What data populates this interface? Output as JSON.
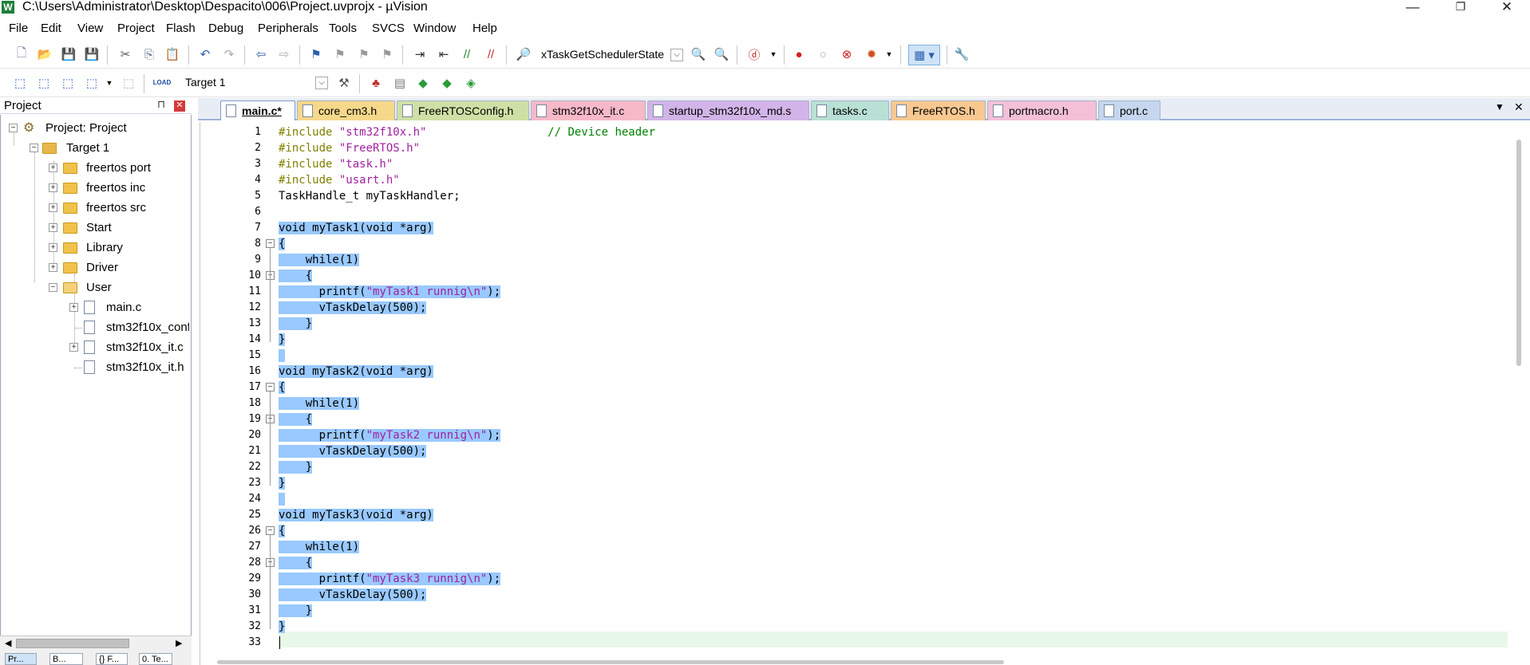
{
  "window": {
    "title": "C:\\Users\\Administrator\\Desktop\\Despacito\\006\\Project.uvprojx - µVision",
    "app_icon": "W"
  },
  "menu": [
    "File",
    "Edit",
    "View",
    "Project",
    "Flash",
    "Debug",
    "Peripherals",
    "Tools",
    "SVCS",
    "Window",
    "Help"
  ],
  "toolbar1": {
    "function_combo": "xTaskGetSchedulerState"
  },
  "toolbar2": {
    "target_combo": "Target 1",
    "load_label": "LOAD"
  },
  "project_panel": {
    "title": "Project",
    "root": "Project: Project",
    "target": "Target 1",
    "groups": [
      "freertos port",
      "freertos inc",
      "freertos src",
      "Start",
      "Library",
      "Driver",
      "User"
    ],
    "files": [
      "main.c",
      "stm32f10x_conf",
      "stm32f10x_it.c",
      "stm32f10x_it.h"
    ],
    "bottom_tabs": [
      "Pr...",
      "B...",
      "{} F...",
      "0. Te..."
    ]
  },
  "tabs": [
    {
      "label": "main.c*",
      "color": "#9db3d8",
      "active": true
    },
    {
      "label": "core_cm3.h",
      "color": "#f5d88a"
    },
    {
      "label": "FreeRTOSConfig.h",
      "color": "#cfe0a6"
    },
    {
      "label": "stm32f10x_it.c",
      "color": "#f7b8c8"
    },
    {
      "label": "startup_stm32f10x_md.s",
      "color": "#d2b4e8"
    },
    {
      "label": "tasks.c",
      "color": "#b9e0d4"
    },
    {
      "label": "FreeRTOS.h",
      "color": "#f9c891"
    },
    {
      "label": "portmacro.h",
      "color": "#f3c0d8"
    },
    {
      "label": "port.c",
      "color": "#c5d6ee"
    }
  ],
  "code": [
    {
      "n": "1",
      "text": "#include \"stm32f10x.h\"                  // Device header"
    },
    {
      "n": "2",
      "text": "#include \"FreeRTOS.h\""
    },
    {
      "n": "3",
      "text": "#include \"task.h\""
    },
    {
      "n": "4",
      "text": "#include \"usart.h\""
    },
    {
      "n": "5",
      "text": "TaskHandle_t myTaskHandler;"
    },
    {
      "n": "6",
      "text": ""
    },
    {
      "n": "7",
      "text": "void myTask1(void *arg)"
    },
    {
      "n": "8",
      "text": "{"
    },
    {
      "n": "9",
      "text": "    while(1)"
    },
    {
      "n": "10",
      "text": "    {"
    },
    {
      "n": "11",
      "text": "      printf(\"myTask1 runnig\\n\");"
    },
    {
      "n": "12",
      "text": "      vTaskDelay(500);"
    },
    {
      "n": "13",
      "text": "    }"
    },
    {
      "n": "14",
      "text": "}"
    },
    {
      "n": "15",
      "text": ""
    },
    {
      "n": "16",
      "text": "void myTask2(void *arg)"
    },
    {
      "n": "17",
      "text": "{"
    },
    {
      "n": "18",
      "text": "    while(1)"
    },
    {
      "n": "19",
      "text": "    {"
    },
    {
      "n": "20",
      "text": "      printf(\"myTask2 runnig\\n\");"
    },
    {
      "n": "21",
      "text": "      vTaskDelay(500);"
    },
    {
      "n": "22",
      "text": "    }"
    },
    {
      "n": "23",
      "text": "}"
    },
    {
      "n": "24",
      "text": ""
    },
    {
      "n": "25",
      "text": "void myTask3(void *arg)"
    },
    {
      "n": "26",
      "text": "{"
    },
    {
      "n": "27",
      "text": "    while(1)"
    },
    {
      "n": "28",
      "text": "    {"
    },
    {
      "n": "29",
      "text": "      printf(\"myTask3 runnig\\n\");"
    },
    {
      "n": "30",
      "text": "      vTaskDelay(500);"
    },
    {
      "n": "31",
      "text": "    }"
    },
    {
      "n": "32",
      "text": "}"
    },
    {
      "n": "33",
      "text": ""
    }
  ],
  "colors": {
    "selection": "#99c9ff",
    "preprocessor": "#808000",
    "string": "#a020a0",
    "comment": "#008000",
    "current_line": "#e8f8e8"
  }
}
